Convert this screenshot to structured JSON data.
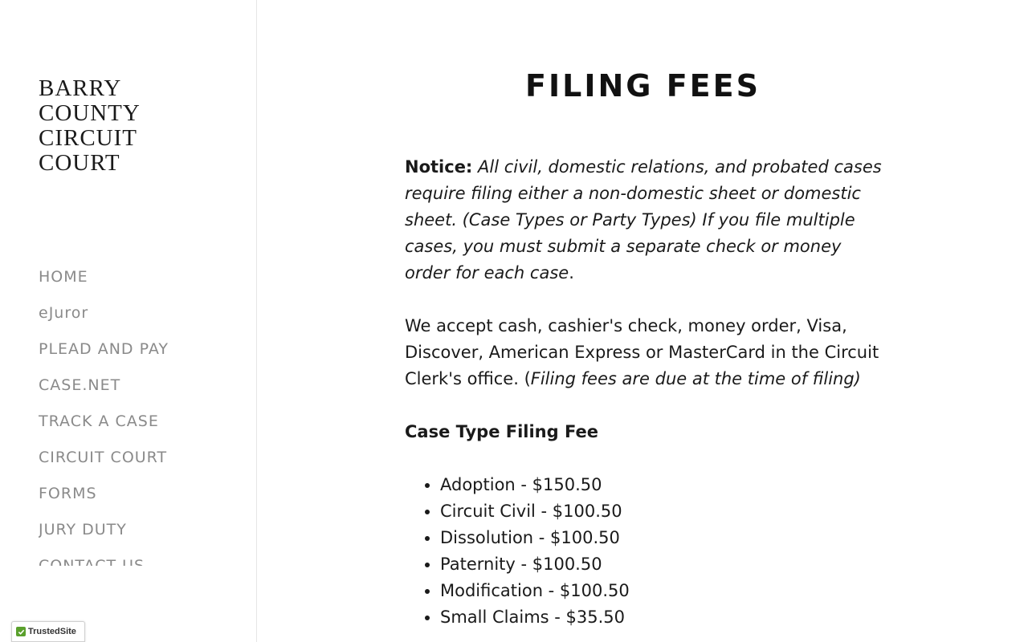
{
  "sidebar": {
    "title_lines": [
      "BARRY",
      "COUNTY",
      "CIRCUIT",
      "COURT"
    ],
    "nav": [
      {
        "label": "HOME"
      },
      {
        "label": "eJuror"
      },
      {
        "label": "PLEAD AND PAY"
      },
      {
        "label": "CASE.NET"
      },
      {
        "label": "TRACK A CASE"
      },
      {
        "label": "CIRCUIT COURT"
      },
      {
        "label": "FORMS"
      },
      {
        "label": "JURY DUTY"
      },
      {
        "label": "CONTACT US"
      }
    ],
    "badge": "TrustedSite"
  },
  "main": {
    "title": "FILING FEES",
    "notice": {
      "label": "Notice:",
      "text_italic": "All civil, domestic relations, and probated cases require filing either a non-domestic sheet or domestic sheet. (Case Types or Party Types) If you file multiple cases, you must submit a separate check or money order for each case",
      "text_end": "."
    },
    "payment": {
      "text": "We accept cash, cashier's check, money order, Visa, Discover, American Express or MasterCard in the Circuit Clerk's office. (",
      "text_italic": "Filing fees are due at the time of filing)"
    },
    "fees_heading": "Case Type Filing Fee",
    "fees": [
      "Adoption - $150.50",
      "Circuit Civil - $100.50",
      "Dissolution - $100.50",
      "Paternity - $100.50",
      "Modification - $100.50",
      "Small Claims - $35.50"
    ]
  },
  "colors": {
    "nav_text": "#8a8a8a",
    "title_text": "#111111",
    "badge_check": "#5aa02c"
  }
}
